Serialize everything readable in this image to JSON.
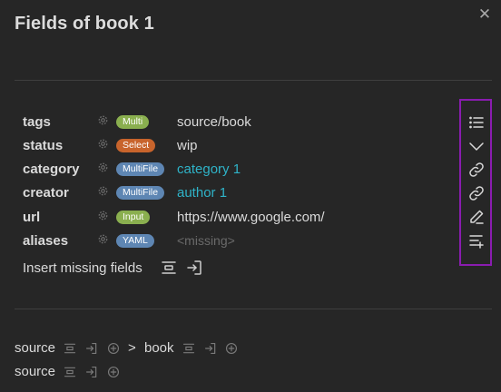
{
  "title": "Fields of book 1",
  "close_glyph": "✕",
  "fields": [
    {
      "name": "tags",
      "type": "Multi",
      "type_color": "#8aaf4f",
      "value": "source/book",
      "value_style": "plain"
    },
    {
      "name": "status",
      "type": "Select",
      "type_color": "#c8642c",
      "value": "wip",
      "value_style": "plain"
    },
    {
      "name": "category",
      "type": "MultiFile",
      "type_color": "#5e86b3",
      "value": "category 1",
      "value_style": "link"
    },
    {
      "name": "creator",
      "type": "MultiFile",
      "type_color": "#5e86b3",
      "value": "author 1",
      "value_style": "link"
    },
    {
      "name": "url",
      "type": "Input",
      "type_color": "#8aaf4f",
      "value": "https://www.google.com/",
      "value_style": "plain"
    },
    {
      "name": "aliases",
      "type": "YAML",
      "type_color": "#5e86b3",
      "value": "<missing>",
      "value_style": "missing"
    }
  ],
  "insert_missing_label": "Insert missing fields",
  "actions": [
    "list-icon",
    "chevron-down-icon",
    "link-icon",
    "link-icon",
    "pencil-icon",
    "list-add-icon"
  ],
  "highlight_color": "#8a1cb0",
  "breadcrumbs": {
    "row1": {
      "first": "source",
      "separator": ">",
      "second": "book"
    },
    "row2": {
      "first": "source"
    }
  }
}
